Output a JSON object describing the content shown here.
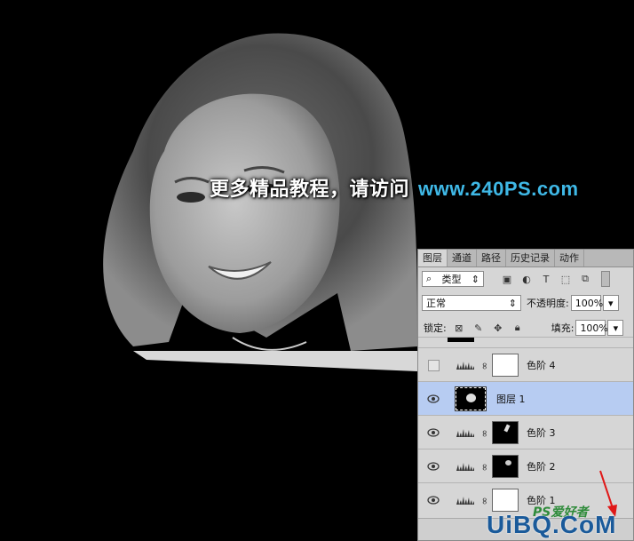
{
  "banner": {
    "text_cn": "更多精品教程，请访问",
    "url": "www.240PS.com"
  },
  "panel": {
    "tabs": [
      "图层",
      "通道",
      "路径",
      "历史记录",
      "动作"
    ],
    "filter_label": "类型",
    "blend_mode": "正常",
    "opacity_label": "不透明度:",
    "opacity_value": "100%",
    "lock_label": "锁定:",
    "fill_label": "填充:",
    "fill_value": "100%",
    "layers": [
      {
        "name": "色阶 4",
        "visible": false,
        "selected": false
      },
      {
        "name": "图层 1",
        "visible": true,
        "selected": true
      },
      {
        "name": "色阶 3",
        "visible": true,
        "selected": false
      },
      {
        "name": "色阶 2",
        "visible": true,
        "selected": false
      },
      {
        "name": "色阶 1",
        "visible": true,
        "selected": false
      }
    ]
  },
  "watermark": {
    "main": "UiBQ.CoM",
    "small": "PS爱好者"
  },
  "colors": {
    "selected_layer": "#b7ccf2",
    "url_text": "#3fb8e6",
    "arrow": "#e01818"
  }
}
